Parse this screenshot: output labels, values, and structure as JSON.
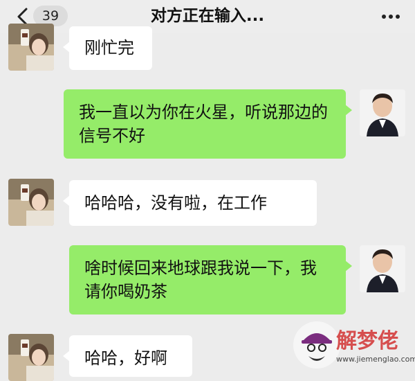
{
  "header": {
    "unread_count": "39",
    "title": "对方正在输入...",
    "back_icon": "chevron-left-icon",
    "more_icon": "more-dots-icon"
  },
  "messages": [
    {
      "side": "left",
      "text": "刚忙完"
    },
    {
      "side": "right",
      "text": "我一直以为你在火星，听说那边的信号不好"
    },
    {
      "side": "left",
      "text": "哈哈哈，没有啦，在工作"
    },
    {
      "side": "right",
      "text": "啥时候回来地球跟我说一下，我请你喝奶茶"
    },
    {
      "side": "left",
      "text": "哈哈，好啊"
    }
  ],
  "colors": {
    "background": "#ececec",
    "self_bubble": "#95ec69",
    "other_bubble": "#ffffff",
    "watermark_red": "#d64e4e"
  },
  "watermark": {
    "name": "解梦佬",
    "url": "www.jiemenglao.com"
  }
}
